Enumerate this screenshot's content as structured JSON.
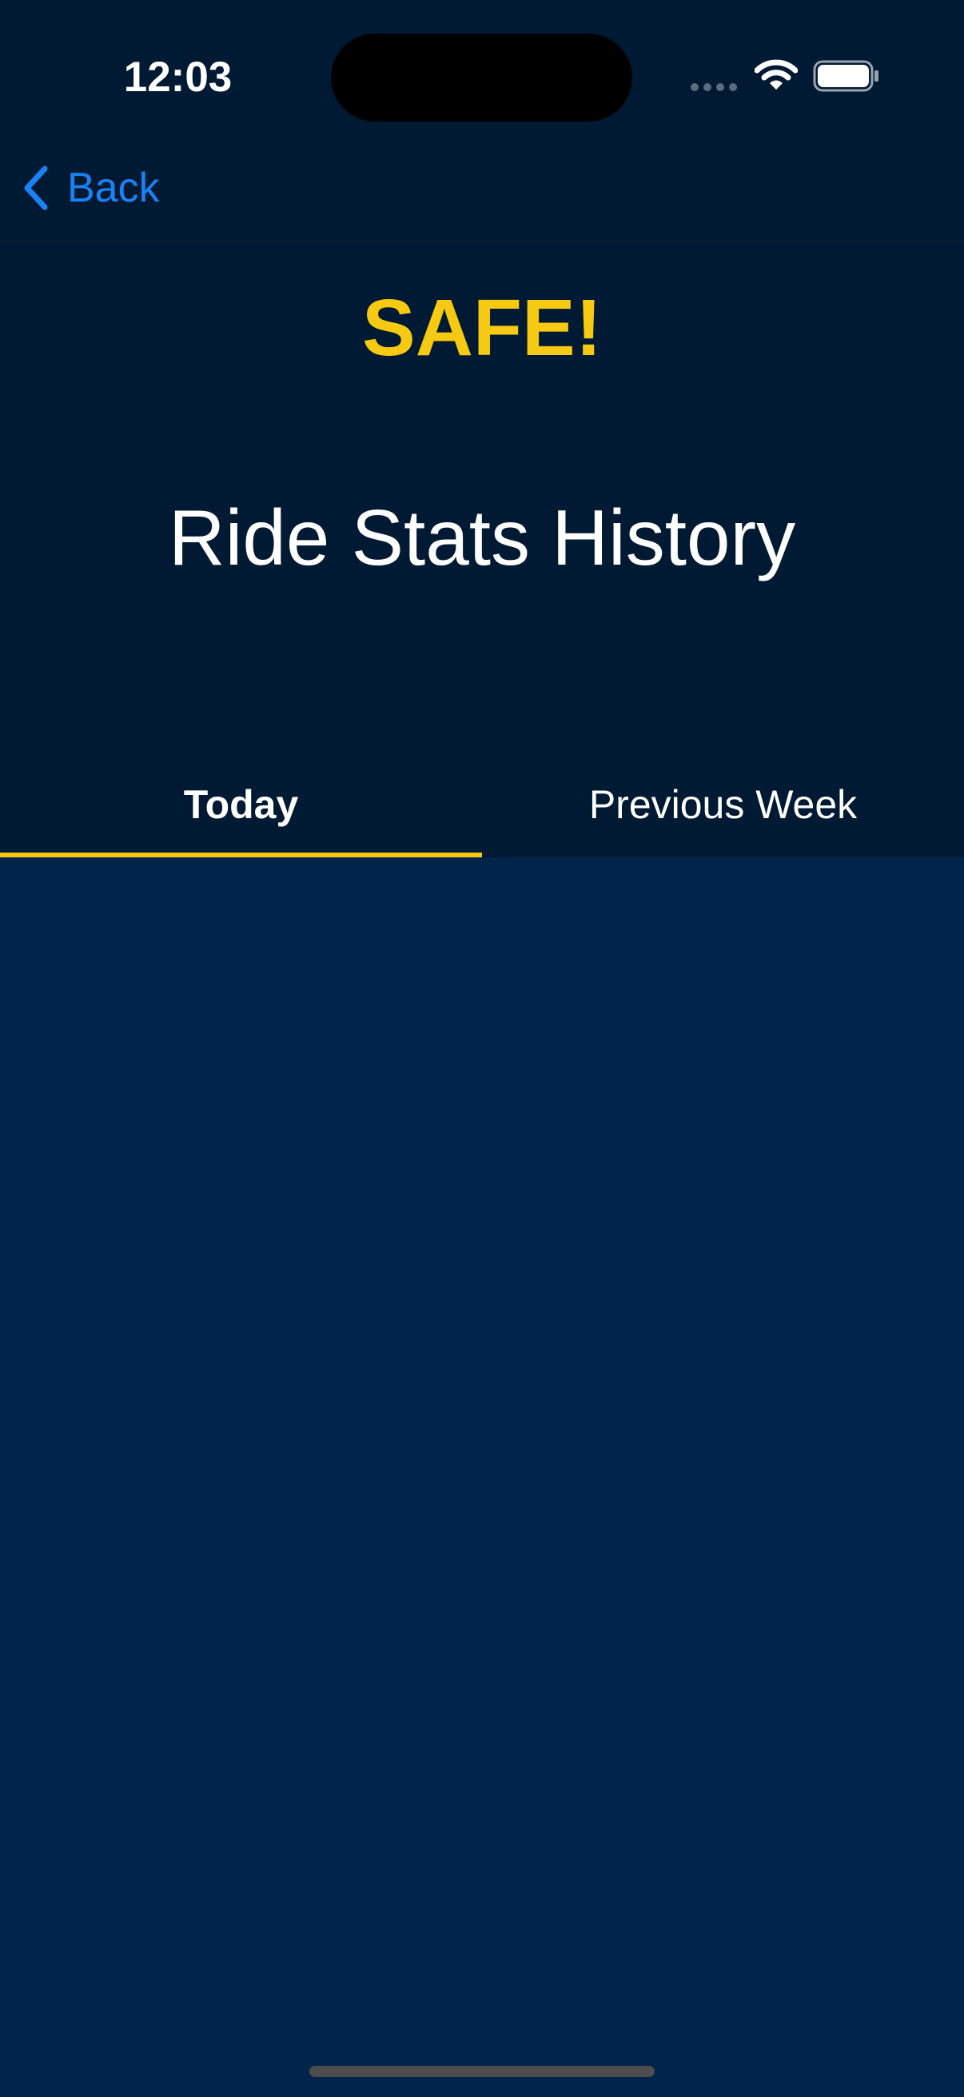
{
  "status_bar": {
    "time": "12:03",
    "icons": [
      "cellular-signal-icon",
      "wifi-icon",
      "battery-icon"
    ]
  },
  "nav": {
    "back_label": "Back",
    "back_icon": "chevron-left-icon"
  },
  "header": {
    "brand": "SAFE!",
    "title": "Ride Stats History"
  },
  "tabs": [
    {
      "label": "Today",
      "selected": true
    },
    {
      "label": "Previous Week",
      "selected": false
    }
  ],
  "colors": {
    "accent": "#f6c912",
    "link": "#1a82f5",
    "header_background": "#011a33",
    "content_background": "#01244b"
  }
}
